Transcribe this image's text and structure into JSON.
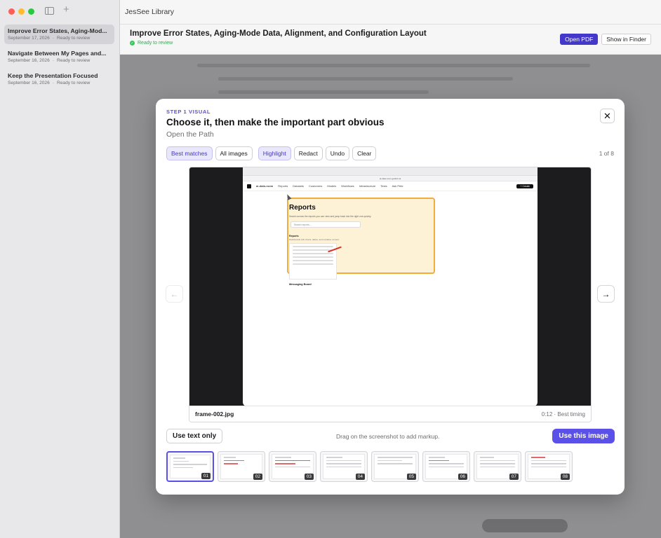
{
  "app": {
    "name": "JesSee Library"
  },
  "sidebar": {
    "items": [
      {
        "title": "Improve Error States, Aging-Mod...",
        "date": "September 17, 2026",
        "status": "Ready to review",
        "active": true
      },
      {
        "title": "Navigate Between My Pages and...",
        "date": "September 16, 2026",
        "status": "Ready to review",
        "active": false
      },
      {
        "title": "Keep the Presentation Focused",
        "date": "September 16, 2026",
        "status": "Ready to review",
        "active": false
      }
    ],
    "separator": "·"
  },
  "document": {
    "title": "Improve Error States, Aging-Mode Data, Alignment, and Configuration Layout",
    "status": "Ready to review",
    "open_pdf_label": "Open PDF",
    "show_in_finder_label": "Show in Finder"
  },
  "modal": {
    "step_label": "STEP 1 VISUAL",
    "title": "Choose it, then make the important part obvious",
    "subtitle": "Open the Path",
    "filters": [
      "Best matches",
      "All images"
    ],
    "selected_filter": "Best matches",
    "tools": [
      "Highlight",
      "Redact",
      "Undo",
      "Clear"
    ],
    "selected_tool": "Highlight",
    "counter": "1 of 8",
    "frame": {
      "filename": "frame-002.jpg",
      "timing": "0:12 · Best timing",
      "url": "ai-data-room.getfortr.ai",
      "nav_items": [
        "Reports",
        "Datasets",
        "Customers",
        "Models",
        "Workflows",
        "Infrastructure",
        "Tests",
        "Ask Pete"
      ],
      "brand": "ai-data-room",
      "create_label": "+ Create",
      "heading": "Reports",
      "description": "Search across the reports you can view and jump back into the right one quickly.",
      "search_placeholder": "Search reports...",
      "section_title": "Reports",
      "section_sub": "Dashboards with charts, tables, and narrative content.",
      "card_title": "Messaging Board"
    },
    "text_only_label": "Use text only",
    "hint": "Drag on the screenshot to add markup.",
    "use_image_label": "Use this image",
    "thumbnails": [
      "01",
      "02",
      "03",
      "04",
      "05",
      "06",
      "07",
      "08"
    ],
    "selected_thumbnail": "01"
  },
  "colors": {
    "accent": "#5b50e8",
    "pdf_button": "#4338ca",
    "highlight_border": "#f0ad3b",
    "success": "#34c759"
  }
}
